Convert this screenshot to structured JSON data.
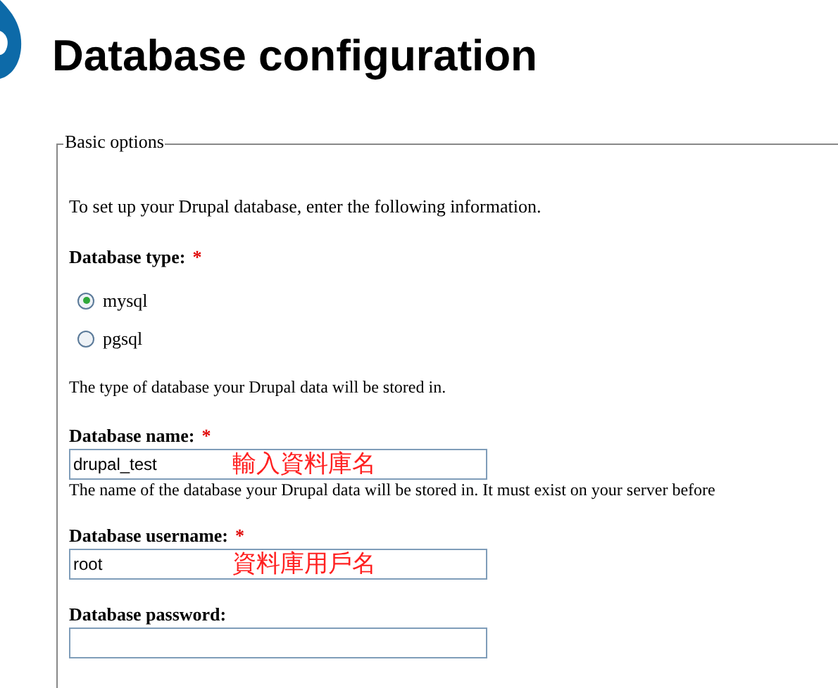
{
  "page": {
    "title": "Database configuration"
  },
  "fieldset": {
    "legend": "Basic options",
    "intro": "To set up your Drupal database, enter the following information.",
    "db_type": {
      "label": "Database type:",
      "required_mark": "*",
      "options": [
        {
          "label": "mysql",
          "selected": true
        },
        {
          "label": "pgsql",
          "selected": false
        }
      ],
      "description": "The type of database your Drupal data will be stored in."
    },
    "fields": [
      {
        "label": "Database name:",
        "required_mark": "*",
        "value": "drupal_test",
        "annotation": "輸入資料庫名",
        "description": "The name of the database your Drupal data will be stored in. It must exist on your server before"
      },
      {
        "label": "Database username:",
        "required_mark": "*",
        "value": "root",
        "annotation": "資料庫用戶名"
      },
      {
        "label": "Database password:"
      }
    ]
  }
}
